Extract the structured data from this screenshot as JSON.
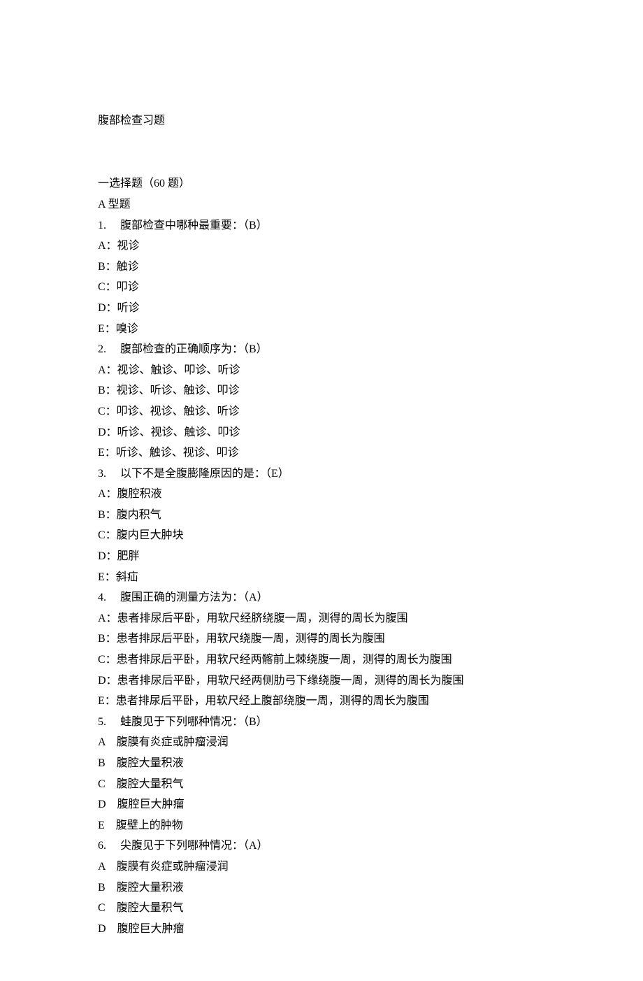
{
  "title": "腹部检查习题",
  "section_header": "一选择题（60 题）",
  "type_header": "A 型题",
  "questions": [
    {
      "num": "1.",
      "text": "腹部检查中哪种最重要：（B）",
      "options": [
        "A：视诊",
        "B：触诊",
        "C：叩诊",
        "D：听诊",
        "E：嗅诊"
      ]
    },
    {
      "num": "2.",
      "text": "腹部检查的正确顺序为：（B）",
      "options": [
        "A：视诊、触诊、叩诊、听诊",
        "B：视诊、听诊、触诊、叩诊",
        "C：叩诊、视诊、触诊、听诊",
        "D：听诊、视诊、触诊、叩诊",
        "E：听诊、触诊、视诊、叩诊"
      ]
    },
    {
      "num": "3.",
      "text": "以下不是全腹膨隆原因的是：（E）",
      "options": [
        "A：腹腔积液",
        "B：腹内积气",
        "C：腹内巨大肿块",
        "D：肥胖",
        "E：斜疝"
      ]
    },
    {
      "num": "4.",
      "text": "腹围正确的测量方法为：（A）",
      "options": [
        "A：患者排尿后平卧，用软尺经脐绕腹一周，测得的周长为腹围",
        "B：患者排尿后平卧，用软尺绕腹一周，测得的周长为腹围",
        "C：患者排尿后平卧，用软尺经两髂前上棘绕腹一周，测得的周长为腹围",
        "D：患者排尿后平卧，用软尺经两侧肋弓下缘绕腹一周，测得的周长为腹围",
        "E：患者排尿后平卧，用软尺经上腹部绕腹一周，测得的周长为腹围"
      ]
    },
    {
      "num": "5.",
      "text": "蛙腹见于下列哪种情况：（B）",
      "options": [
        "A　腹膜有炎症或肿瘤浸润",
        "B　腹腔大量积液",
        "C　腹腔大量积气",
        "D　腹腔巨大肿瘤",
        "E　腹壁上的肿物"
      ]
    },
    {
      "num": "6.",
      "text": "尖腹见于下列哪种情况：（A）",
      "options": [
        "A　腹膜有炎症或肿瘤浸润",
        "B　腹腔大量积液",
        "C　腹腔大量积气",
        "D　腹腔巨大肿瘤"
      ]
    }
  ]
}
